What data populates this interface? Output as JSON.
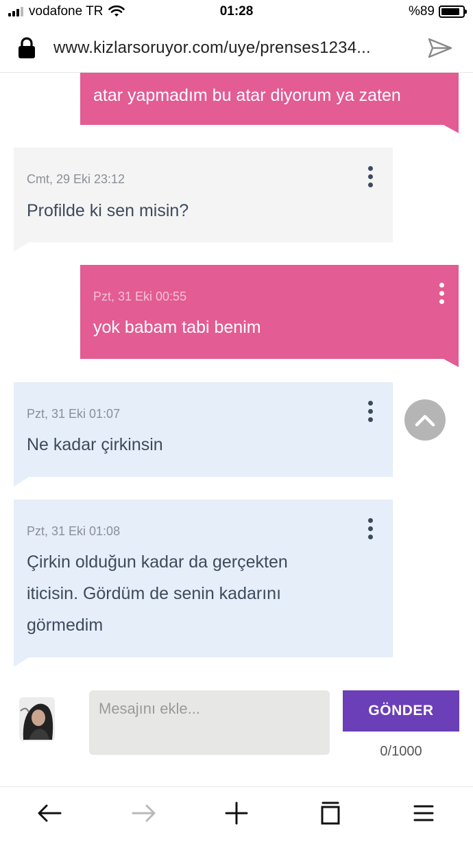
{
  "status_bar": {
    "carrier": "vodafone TR",
    "time": "01:28",
    "battery": "%89"
  },
  "address_bar": {
    "url": "www.kizlarsoruyor.com/uye/prenses1234..."
  },
  "messages": [
    {
      "time": "",
      "text": "atar yapmadım bu atar diyorum ya zaten"
    },
    {
      "time": "Cmt, 29 Eki 23:12",
      "text": "Profilde ki sen misin?"
    },
    {
      "time": "Pzt, 31 Eki 00:55",
      "text": "yok babam tabi benim"
    },
    {
      "time": "Pzt, 31 Eki 01:07",
      "text": "Ne kadar çirkinsin"
    },
    {
      "time": "Pzt, 31 Eki 01:08",
      "text_lines": [
        "Çirkin olduğun kadar da gerçekten",
        "iticisin. Gördüm de senin kadarını",
        "görmedim"
      ]
    }
  ],
  "composer": {
    "placeholder": "Mesajını ekle...",
    "value": "",
    "send_label": "GÖNDER",
    "counter": "0/1000"
  },
  "colors": {
    "sent_bubble": "#e35c94",
    "received_gray": "#f4f4f4",
    "received_blue": "#e6eef9",
    "send_button": "#6b3fb7"
  }
}
